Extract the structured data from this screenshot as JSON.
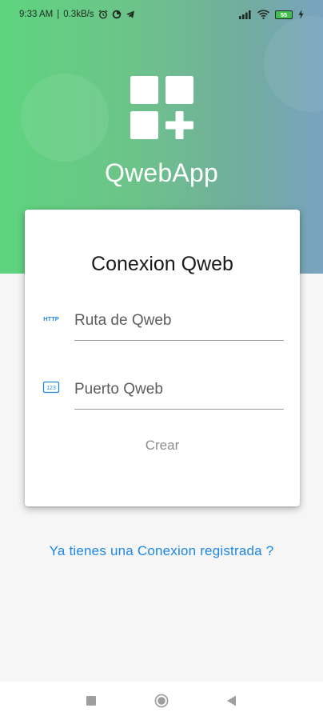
{
  "status_bar": {
    "time": "9:33 AM",
    "network_speed": "0.3kB/s",
    "left_icons": [
      "alarm-icon",
      "app-notification-icon",
      "telegram-icon"
    ],
    "right_icons": [
      "signal-icon",
      "wifi-icon",
      "battery-icon",
      "charging-icon"
    ],
    "battery_level": "55"
  },
  "header": {
    "app_name": "QwebApp",
    "gradient_start": "#5ed47e",
    "gradient_end": "#79a3bf",
    "logo_icon": "grid-plus-icon"
  },
  "card": {
    "title": "Conexion Qweb",
    "fields": [
      {
        "icon": "http-icon",
        "icon_text": "HTTP",
        "placeholder": "Ruta de Qweb",
        "value": ""
      },
      {
        "icon": "numeric-keypad-icon",
        "icon_text": "123",
        "placeholder": "Puerto Qweb",
        "value": ""
      }
    ],
    "submit_label": "Crear"
  },
  "registered_link": {
    "label": "Ya tienes una Conexion registrada ?",
    "color": "#1e88e5"
  },
  "nav_bar": {
    "buttons": [
      "recent-apps-icon",
      "home-icon",
      "back-icon"
    ]
  }
}
